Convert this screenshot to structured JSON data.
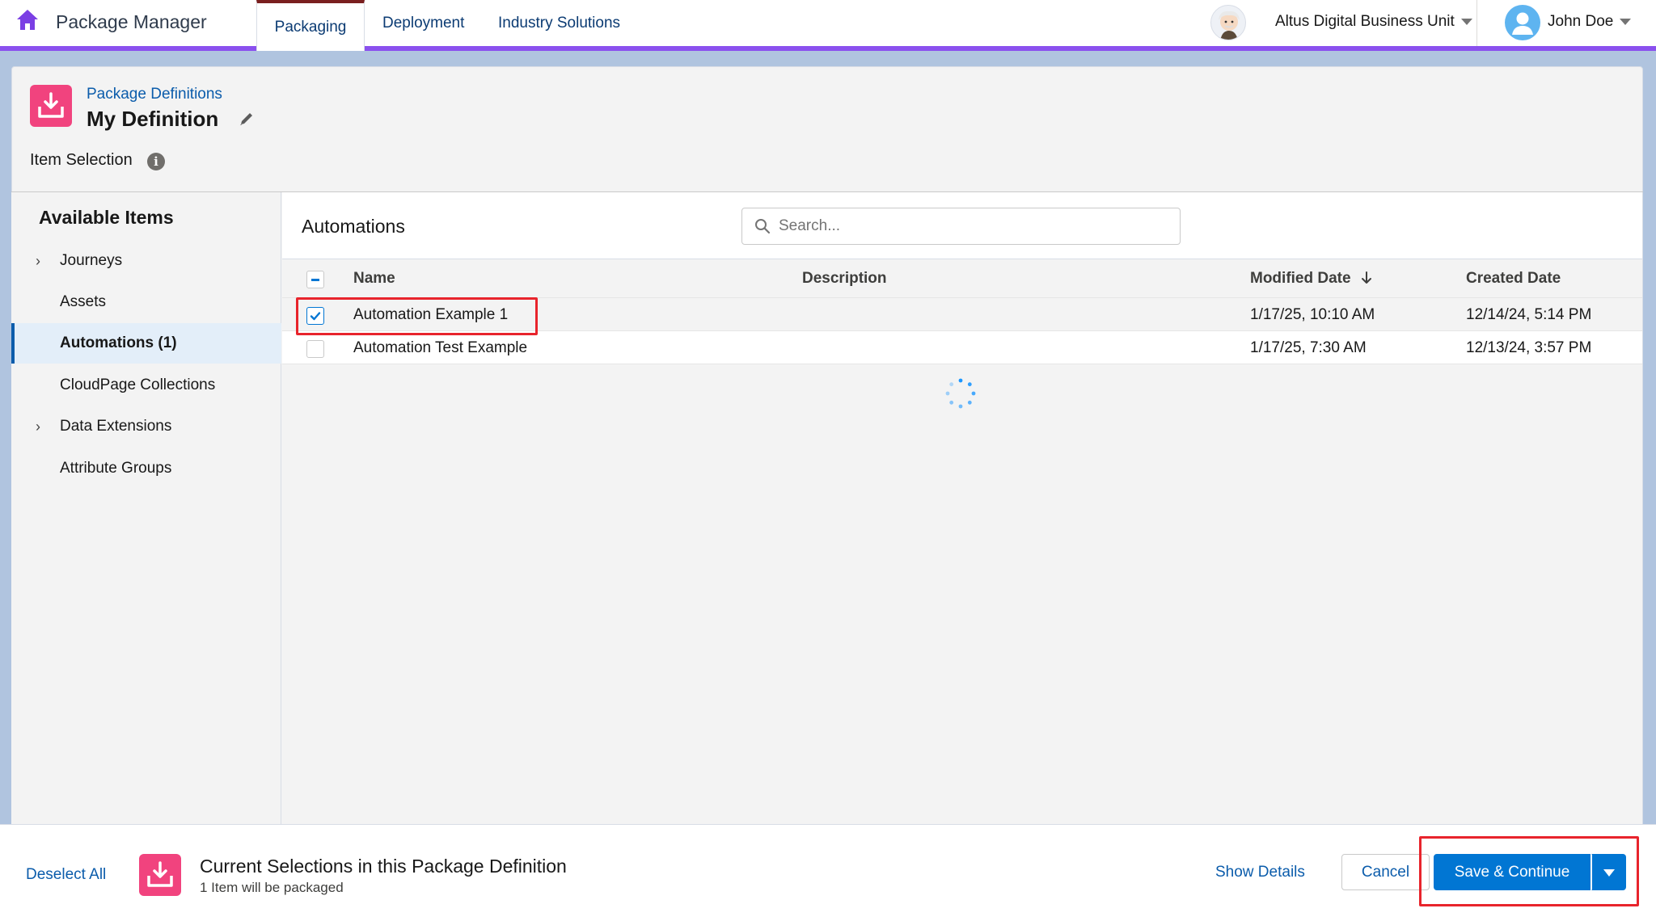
{
  "app": {
    "name": "Package Manager",
    "home_icon": "home-icon"
  },
  "nav": {
    "tabs": [
      {
        "label": "Packaging",
        "active": true
      },
      {
        "label": "Deployment",
        "active": false
      },
      {
        "label": "Industry Solutions",
        "active": false
      }
    ],
    "business_unit": "Altus Digital Business Unit",
    "user": "John Doe"
  },
  "header": {
    "breadcrumb": "Package Definitions",
    "title": "My Definition",
    "subtitle": "Item Selection"
  },
  "sidebar": {
    "title": "Available Items",
    "items": [
      {
        "label": "Journeys",
        "expandable": true,
        "active": false
      },
      {
        "label": "Assets",
        "expandable": false,
        "active": false
      },
      {
        "label": "Automations (1)",
        "expandable": false,
        "active": true
      },
      {
        "label": "CloudPage Collections",
        "expandable": false,
        "active": false
      },
      {
        "label": "Data Extensions",
        "expandable": true,
        "active": false
      },
      {
        "label": "Attribute Groups",
        "expandable": false,
        "active": false
      }
    ]
  },
  "main": {
    "title": "Automations",
    "search": {
      "placeholder": "Search...",
      "value": ""
    },
    "columns": {
      "name": "Name",
      "description": "Description",
      "modified": "Modified Date",
      "created": "Created Date"
    },
    "rows": [
      {
        "checked": true,
        "name": "Automation Example 1",
        "description": "",
        "modified": "1/17/25, 10:10 AM",
        "created": "12/14/24, 5:14 PM"
      },
      {
        "checked": false,
        "name": "Automation Test Example",
        "description": "",
        "modified": "1/17/25, 7:30 AM",
        "created": "12/13/24, 3:57 PM"
      }
    ]
  },
  "footer": {
    "deselect_all": "Deselect All",
    "title": "Current Selections in this Package Definition",
    "subtitle": "1 Item will be packaged",
    "show_details": "Show Details",
    "cancel": "Cancel",
    "save": "Save & Continue"
  },
  "colors": {
    "accent": "#8a50ee",
    "brand_blue": "#0176d3",
    "package_icon": "#f1437e",
    "highlight": "#e8242c"
  }
}
